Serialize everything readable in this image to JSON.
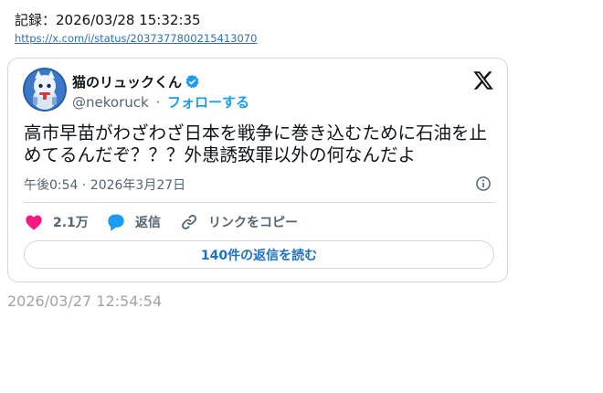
{
  "record": {
    "label": "記録：2026/03/28 15:32:35",
    "url": "https://x.com/i/status/2037377800215413070"
  },
  "tweet": {
    "display_name": "猫のリュックくん",
    "handle": "@nekoruck",
    "separator": "·",
    "follow_label": "フォローする",
    "text": "高市早苗がわざわざ日本を戦争に巻き込むために石油を止めてるんだぞ？？？外患誘致罪以外の何なんだよ",
    "timestamp": "午後0:54 · 2026年3月27日",
    "likes": "2.1万",
    "reply_label": "返信",
    "copy_link_label": "リンクをコピー",
    "replies_button": "140件の返信を読む",
    "like_color": "#f91880",
    "reply_color": "#1d9bf0",
    "verified_color": "#1d9bf0"
  },
  "footer": {
    "capture_time": "2026/03/27 12:54:54"
  }
}
